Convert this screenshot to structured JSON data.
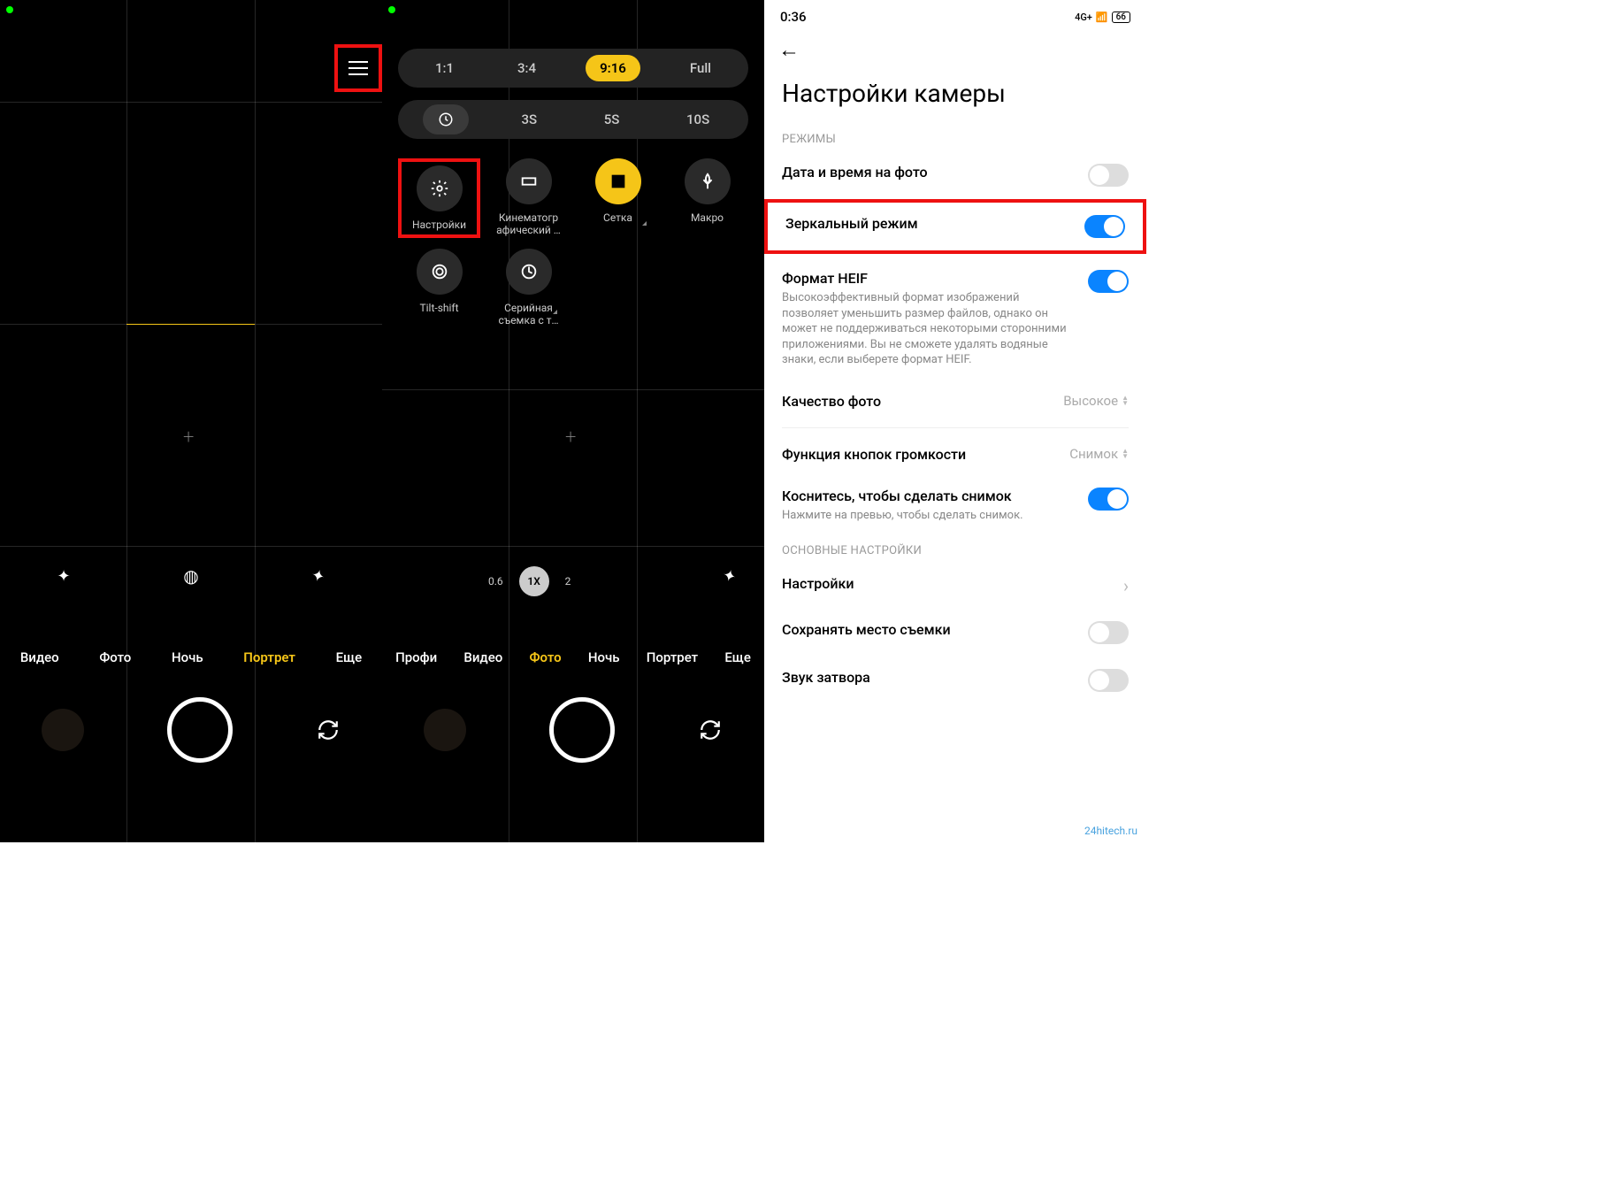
{
  "panel1": {
    "modes": [
      "Видео",
      "Фото",
      "Ночь",
      "Портрет",
      "Еще"
    ],
    "active_mode_index": 3
  },
  "panel2": {
    "aspect": {
      "items": [
        "1:1",
        "3:4",
        "9:16",
        "Full"
      ],
      "active_index": 2
    },
    "timer": {
      "items": [
        "3S",
        "5S",
        "10S"
      ]
    },
    "tools": [
      {
        "name": "settings",
        "label": "Настройки"
      },
      {
        "name": "cinematic",
        "label": "Кинематогр афический …"
      },
      {
        "name": "grid",
        "label": "Сетка"
      },
      {
        "name": "macro",
        "label": "Макро"
      },
      {
        "name": "tiltshift",
        "label": "Tilt-shift"
      },
      {
        "name": "burst",
        "label": "Серийная съемка с т…"
      }
    ],
    "active_tool_index": 2,
    "zoom": {
      "items": [
        "0.6",
        "1X",
        "2"
      ],
      "active_index": 1
    },
    "modes": [
      "Профи",
      "Видео",
      "Фото",
      "Ночь",
      "Портрет",
      "Еще"
    ],
    "active_mode_index": 2
  },
  "panel3": {
    "status": {
      "time": "0:36",
      "net": "4G+",
      "battery": "66"
    },
    "title": "Настройки камеры",
    "sections": {
      "modes_label": "РЕЖИМЫ",
      "main_label": "ОСНОВНЫЕ НАСТРОЙКИ"
    },
    "items": {
      "datetime": {
        "title": "Дата и время на фото"
      },
      "mirror": {
        "title": "Зеркальный режим"
      },
      "heif": {
        "title": "Формат HEIF",
        "sub": "Высокоэффективный формат изображений позволяет уменьшить размер файлов, однако он может не поддерживаться некоторыми сторонними приложениями. Вы не сможете удалять водяные знаки, если выберете формат HEIF."
      },
      "quality": {
        "title": "Качество фото",
        "value": "Высокое"
      },
      "volume": {
        "title": "Функция кнопок громкости",
        "value": "Снимок"
      },
      "tap": {
        "title": "Коснитесь, чтобы сделать снимок",
        "sub": "Нажмите на превью, чтобы сделать снимок."
      },
      "settings": {
        "title": "Настройки"
      },
      "location": {
        "title": "Сохранять место съемки"
      },
      "shutter_sound": {
        "title": "Звук затвора"
      }
    }
  },
  "watermark": "24hitech.ru"
}
